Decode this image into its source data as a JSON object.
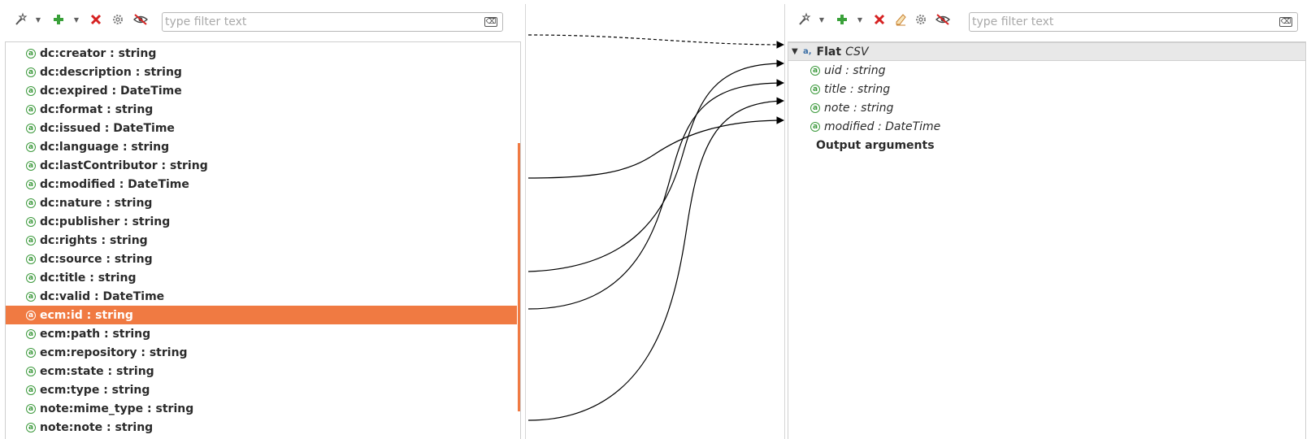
{
  "left": {
    "filter_placeholder": "type filter text",
    "clear_glyph": "⌫",
    "items": [
      {
        "label": "dc:creator : string"
      },
      {
        "label": "dc:description : string"
      },
      {
        "label": "dc:expired : DateTime"
      },
      {
        "label": "dc:format : string"
      },
      {
        "label": "dc:issued : DateTime"
      },
      {
        "label": "dc:language : string"
      },
      {
        "label": "dc:lastContributor : string"
      },
      {
        "label": "dc:modified : DateTime"
      },
      {
        "label": "dc:nature : string"
      },
      {
        "label": "dc:publisher : string"
      },
      {
        "label": "dc:rights : string"
      },
      {
        "label": "dc:source : string"
      },
      {
        "label": "dc:title : string"
      },
      {
        "label": "dc:valid : DateTime"
      },
      {
        "label": "ecm:id : string",
        "selected": true
      },
      {
        "label": "ecm:path : string"
      },
      {
        "label": "ecm:repository : string"
      },
      {
        "label": "ecm:state : string"
      },
      {
        "label": "ecm:type : string"
      },
      {
        "label": "note:mime_type : string"
      },
      {
        "label": "note:note : string"
      }
    ]
  },
  "right": {
    "filter_placeholder": "type filter text",
    "clear_glyph": "⌫",
    "root": {
      "name": "Flat",
      "type": "CSV"
    },
    "fields": [
      {
        "label": "uid : string"
      },
      {
        "label": "title : string"
      },
      {
        "label": "note : string"
      },
      {
        "label": "modified : DateTime"
      }
    ],
    "output_arguments": "Output arguments"
  },
  "attribute_icon_glyph": "a",
  "colors": {
    "selection": "#f07a42",
    "attribute_icon": "#3d9a3d",
    "delete": "#d62222",
    "add": "#3aa13a"
  },
  "icons": {
    "left_toolbar": [
      "magic-wand-icon",
      "add-icon",
      "delete-icon",
      "settings-icon",
      "hide-icon"
    ],
    "right_toolbar": [
      "magic-wand-icon",
      "add-icon",
      "delete-icon",
      "eraser-icon",
      "settings-icon",
      "hide-icon"
    ]
  }
}
